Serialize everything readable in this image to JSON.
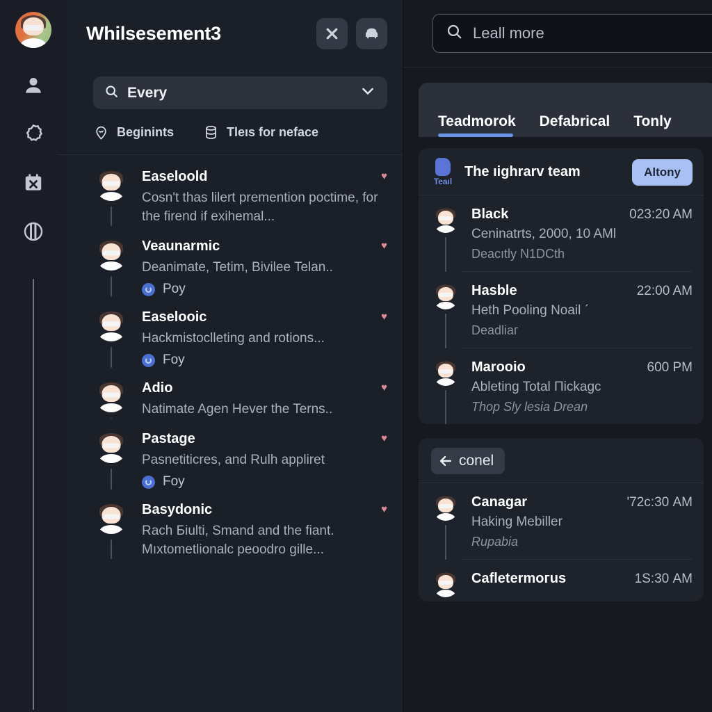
{
  "rail": {
    "avatar_name": "user-avatar",
    "items": [
      {
        "icon": "person-icon",
        "name": "rail-item-profile"
      },
      {
        "icon": "gear-badge-icon",
        "name": "rail-item-settings"
      },
      {
        "icon": "calendar-x-icon",
        "name": "rail-item-calendar"
      },
      {
        "icon": "split-circle-icon",
        "name": "rail-item-contrast"
      }
    ]
  },
  "left": {
    "title": "Whilsesement3",
    "close_label": "✕",
    "sofa_label": "sofa-icon",
    "search": {
      "value": "Every",
      "placeholder": "Every"
    },
    "filters": [
      {
        "icon": "location-pin-icon",
        "label": "Beginints"
      },
      {
        "icon": "database-icon",
        "label": "Tleıs for neface"
      }
    ],
    "conversations": [
      {
        "name": "Easeloold",
        "snippet": "Cosn't thas lilert premention poctime, for the firend if exihemal...",
        "tag": null,
        "favorite": true
      },
      {
        "name": "Veaunarmiс",
        "snippet": "Deanimate, Tetim, Bivilee Telan..",
        "tag": "Poy",
        "favorite": true
      },
      {
        "name": "Easelooic",
        "snippet": "Hackmistoclleting and rotions...",
        "tag": "Foy",
        "favorite": true
      },
      {
        "name": "Adio",
        "snippet": "Natimate Agen Hever the Terns..",
        "tag": null,
        "favorite": true
      },
      {
        "name": "Pastage",
        "snippet": "Pasnetiticres, and Rulh appliret",
        "tag": "Foy",
        "favorite": true
      },
      {
        "name": "Basydonic",
        "snippet": "Rach Бiulti, Smand and the fiant. Mıxtometlionalc peoodro gille...",
        "tag": null,
        "favorite": true
      }
    ]
  },
  "right": {
    "search": {
      "placeholder": "Leall more",
      "icon": "search-icon"
    },
    "tabs": [
      {
        "label": "Teadmorok",
        "active": true
      },
      {
        "label": "Defabrical",
        "active": false
      },
      {
        "label": "Tonly",
        "active": false
      }
    ],
    "cards": [
      {
        "type": "team",
        "logo_label": "Teaıl",
        "title": "The ıighrarv team",
        "action_label": "Altony",
        "messages": [
          {
            "name": "Blaсk",
            "time": "023:20 AM",
            "line1": "Ceninatrts, 2000, 10 AМl",
            "line2": "Deacıtly N1DCth",
            "line2_italic": false
          },
          {
            "name": "Hasble",
            "time": "22:00 AM",
            "line1": "Heth Pooling Noail ˊ",
            "line2": "Deadliaг",
            "line2_italic": false
          },
          {
            "name": "Marooio",
            "time": "600 PM",
            "line1": "Ableting Total Пickagc",
            "line2": "Thop Slу lesia Drean",
            "line2_italic": true
          }
        ]
      },
      {
        "type": "back",
        "back_label": "сonel",
        "messages": [
          {
            "name": "Canagar",
            "time": "'72с:30 AM",
            "line1": "Haking Mebiller",
            "line2": "Rupabia",
            "line2_italic": true
          },
          {
            "name": "Cafletermогus",
            "time": "1Ѕ:30 AM",
            "line1": "",
            "line2": "",
            "line2_italic": false
          }
        ]
      }
    ]
  },
  "colors": {
    "app_bg": "#171a21",
    "rail_bg": "#1a1d25",
    "left_bg": "#1b1f28",
    "right_bg": "#161920",
    "card_bg": "#1e222b",
    "accent_blue": "#6b93e6",
    "pill_blue": "#a9c0f5",
    "heart_pink": "#d98a96",
    "tag_blue": "#4a6fd0"
  }
}
